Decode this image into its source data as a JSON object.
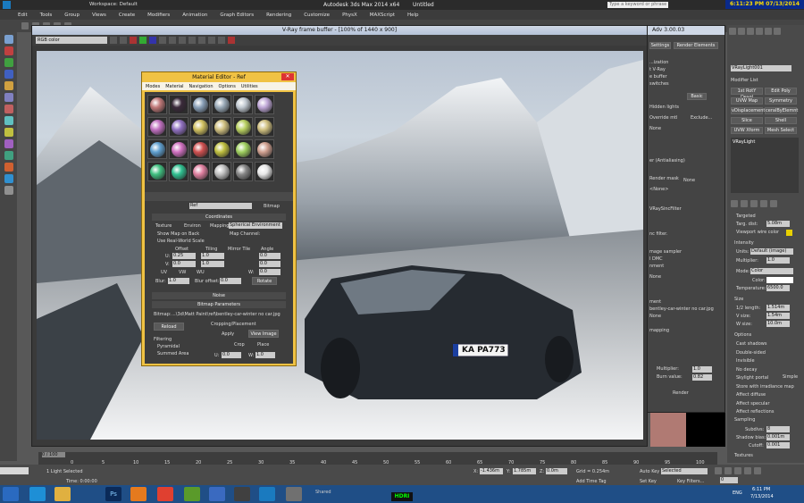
{
  "app": {
    "workspace": "Workspace: Default",
    "title": "Autodesk 3ds Max  2014 x64",
    "doc": "Untitled",
    "search_placeholder": "Type a keyword or phrase",
    "clock": "6:11:23 PM 07/13/2014"
  },
  "menu": [
    "Edit",
    "Tools",
    "Group",
    "Views",
    "Create",
    "Modifiers",
    "Animation",
    "Graph Editors",
    "Rendering",
    "Customize",
    "PhysX",
    "MAXScript",
    "Help"
  ],
  "vfb": {
    "title": "V-Ray frame buffer - [100% of 1440 x 900]",
    "channel": "RGB color",
    "plate": "KA PA773"
  },
  "material_editor": {
    "title": "Material Editor - Ref",
    "menu": [
      "Modes",
      "Material",
      "Navigation",
      "Options",
      "Utilities"
    ],
    "name_value": "Ref",
    "type_button": "Bitmap",
    "coords_header": "Coordinates",
    "texture": "Texture",
    "environ": "Environ",
    "mapping_label": "Mapping:",
    "mapping_value": "Spherical Environment",
    "show_map": "Show Map on Back",
    "use_real": "Use Real-World Scale",
    "map_channel": "Map Channel:",
    "offset": "Offset",
    "tiling": "Tiling",
    "mirror_tile": "Mirror Tile",
    "angle": "Angle",
    "u": "U:",
    "v": "V:",
    "w": "W:",
    "offset_u": "0.25",
    "offset_v": "0.0",
    "tiling_u": "1.0",
    "tiling_v": "1.0",
    "angle_u": "0.0",
    "angle_v": "0.0",
    "angle_w": "0.0",
    "uv": "UV",
    "vw": "VW",
    "wu": "WU",
    "blur": "Blur:",
    "blur_val": "1.0",
    "blur_offset": "Blur offset:",
    "blur_offset_val": "0.0",
    "rotate": "Rotate",
    "noise": "Noise",
    "bitmap_params": "Bitmap Parameters",
    "bitmap_label": "Bitmap:",
    "bitmap_path": "...\\3d\\Matt Paint\\ref\\bentley-car-winter no car.jpg",
    "reload": "Reload",
    "cropping": "Cropping/Placement",
    "apply": "Apply",
    "view_image": "View Image",
    "filtering": "Filtering",
    "pyramidal": "Pyramidal",
    "summed": "Summed Area",
    "crop": "Crop",
    "place": "Place",
    "u_small": "U:",
    "w_small": "W:",
    "u0": "0.0",
    "w1": "1.0"
  },
  "render_setup": {
    "title": "Adv 3.00.03",
    "tabs": [
      "Settings",
      "Render Elements"
    ],
    "rows": [
      "...ization",
      "t V-Ray",
      "e buffer",
      "switches",
      "Hidden lights",
      "Override mtl",
      "Exclude...",
      "None",
      "er (Antialiasing)",
      "Render mask",
      "None",
      "<None>",
      "VRaySincFilter",
      "nc filter.",
      "mage sampler",
      "l DMC",
      "nment",
      "None",
      "ment",
      "bentley-car-winter no car.jpg",
      "None",
      "mapping",
      "Multiplier:",
      "Burn value:",
      "Render"
    ],
    "basic": "Basic",
    "multiplier_val": "1.0",
    "burn_val": "0.82"
  },
  "command_panel": {
    "object": "VRayLight001",
    "modifier_list": "Modifier List",
    "buttons": [
      "1st RotY Desgl",
      "Edit Poly",
      "UVW Map",
      "Symmetry",
      "vDisplacementM",
      "ceralByElemnt",
      "Slice",
      "Shell",
      "UVW Xform",
      "Mesh Select"
    ],
    "stack_item": "VRayLight",
    "targeted": "Targeted",
    "targ_dist": "Targ. dist:",
    "targ_val": "5.08m",
    "viewport_wire": "Viewport wire color",
    "intensity": "Intensity",
    "units": "Units:",
    "units_val": "Default (image)",
    "multiplier": "Multiplier:",
    "multiplier_val": "1.0",
    "mode": "Mode:",
    "mode_val": "Color",
    "color": "Color:",
    "temperature": "Temperature:",
    "temp_val": "6500.0",
    "size": "Size",
    "half_length": "1/2 length:",
    "hl_val": "1.514m",
    "v_size": "V size:",
    "vs_val": "1.54m",
    "w_size": "W size:",
    "ws_val": "10.0m",
    "options": "Options",
    "opts": [
      "Cast shadows",
      "Double-sided",
      "Invisible",
      "No decay",
      "Skylight portal",
      "Store with irradiance map",
      "Affect diffuse",
      "Affect specular",
      "Affect reflections"
    ],
    "simple": "Simple",
    "sampling": "Sampling",
    "subdivs": "Subdivs:",
    "subdivs_val": "8",
    "shadow_bias": "Shadow bias:",
    "sb_val": "0.001m",
    "cutoff": "Cutoff:",
    "cutoff_val": "0.001",
    "textures": "Textures"
  },
  "timeline": {
    "frame": "0 / 100",
    "ticks": [
      "0",
      "5",
      "10",
      "15",
      "20",
      "25",
      "30",
      "35",
      "40",
      "45",
      "50",
      "55",
      "60",
      "65",
      "70",
      "75",
      "80",
      "85",
      "90",
      "95",
      "100"
    ]
  },
  "status": {
    "selected": "1 Light Selected",
    "time": "Time: 0:00:00",
    "x": "-1.436m",
    "y": "1.785m",
    "z": "0.0m",
    "grid": "Grid = 0.254m",
    "add_tag": "Add Time Tag",
    "auto_key": "Auto Key",
    "selected_drop": "Selected",
    "set_key": "Set Key",
    "key_filters": "Key Filters...",
    "frame_no": "0",
    "shared": "Shared"
  },
  "taskbar": {
    "lang": "ENG",
    "time": "6:11 PM",
    "date": "7/13/2014",
    "hdr": "HDRI"
  }
}
